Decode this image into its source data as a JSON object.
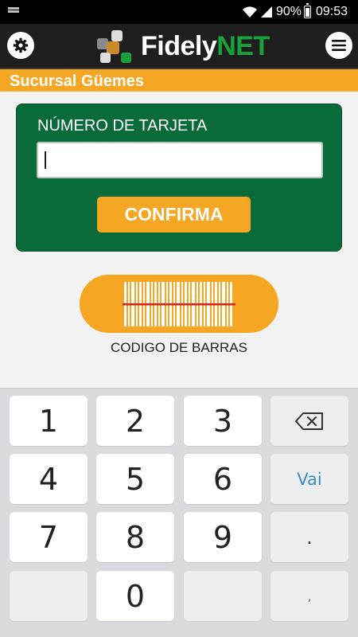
{
  "status_bar": {
    "battery": "90%",
    "time": "09:53"
  },
  "header": {
    "logo_part1": "Fidely",
    "logo_part2": "NET",
    "logo_colors": [
      "#8a8a8a",
      "#c98a2a",
      "#dcdcdc",
      "#19a23a"
    ]
  },
  "branch": {
    "title": "Sucursal Güemes"
  },
  "card_form": {
    "label": "NÚMERO DE TARJETA",
    "input_value": "",
    "input_placeholder": "",
    "confirm_label": "CONFIRMA"
  },
  "barcode": {
    "label": "CODIGO DE BARRAS",
    "icon": "barcode-scan-icon"
  },
  "keypad": {
    "keys": [
      "1",
      "2",
      "3",
      "4",
      "5",
      "6",
      "7",
      "8",
      "9",
      "0"
    ],
    "go_label": "Vai",
    "dot_label": ".",
    "comma_label": ",",
    "backspace_icon": "backspace-icon"
  },
  "colors": {
    "accent_orange": "#f5a623",
    "card_green": "#0a6b3a",
    "header_dark": "#1e1e1e"
  }
}
